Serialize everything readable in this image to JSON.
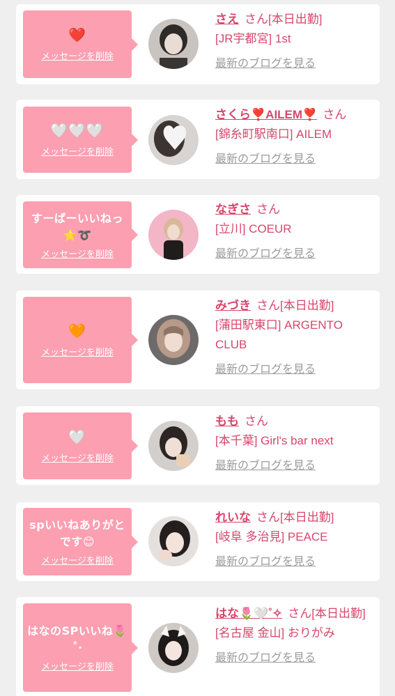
{
  "cards": [
    {
      "message": "❤️",
      "delete_label": "メッセージを削除",
      "name": "さえ",
      "honorific": "さん",
      "status": "[本日出勤]",
      "shop": "[JR宇都宮] 1st",
      "blog_label": "最新のブログを見る",
      "avatar_icon": "portrait-photo"
    },
    {
      "message": "🤍🤍🤍",
      "delete_label": "メッセージを削除",
      "name": "さくら❣️AILEM❣️",
      "honorific": "さん",
      "status": "",
      "shop": "[錦糸町駅南口] AILEM",
      "blog_label": "最新のブログを見る",
      "avatar_icon": "portrait-photo"
    },
    {
      "message": "すーぱーいいねっ⭐️➰",
      "delete_label": "メッセージを削除",
      "name": "なぎさ",
      "honorific": "さん",
      "status": "",
      "shop": "[立川] COEUR",
      "blog_label": "最新のブログを見る",
      "avatar_icon": "portrait-photo"
    },
    {
      "message": "🧡",
      "delete_label": "メッセージを削除",
      "name": "みづき",
      "honorific": "さん",
      "status": "[本日出勤]",
      "shop": "[蒲田駅東口] ARGENTO CLUB",
      "blog_label": "最新のブログを見る",
      "avatar_icon": "portrait-photo"
    },
    {
      "message": "🤍",
      "delete_label": "メッセージを削除",
      "name": "もも",
      "honorific": "さん",
      "status": "",
      "shop": "[本千葉] Girl's bar next",
      "blog_label": "最新のブログを見る",
      "avatar_icon": "portrait-photo"
    },
    {
      "message": "spいいねありがとです😊",
      "delete_label": "メッセージを削除",
      "name": "れいな",
      "honorific": "さん",
      "status": "[本日出勤]",
      "shop": "[岐阜 多治見] PEACE",
      "blog_label": "最新のブログを見る",
      "avatar_icon": "portrait-photo"
    },
    {
      "message": "はなのSPいいね🌷˚‧",
      "delete_label": "メッセージを削除",
      "name": "はな🌷🤍˚✧",
      "honorific": "さん",
      "status": "[本日出勤]",
      "shop": "[名古屋 金山] おりがみ",
      "blog_label": "最新のブログを見る",
      "avatar_icon": "portrait-photo"
    }
  ],
  "colors": {
    "accent": "#d6476c",
    "bubble": "#fb9fb1",
    "muted_link": "#9b9b9b",
    "page_bg": "#efefef",
    "card_bg": "#ffffff"
  }
}
